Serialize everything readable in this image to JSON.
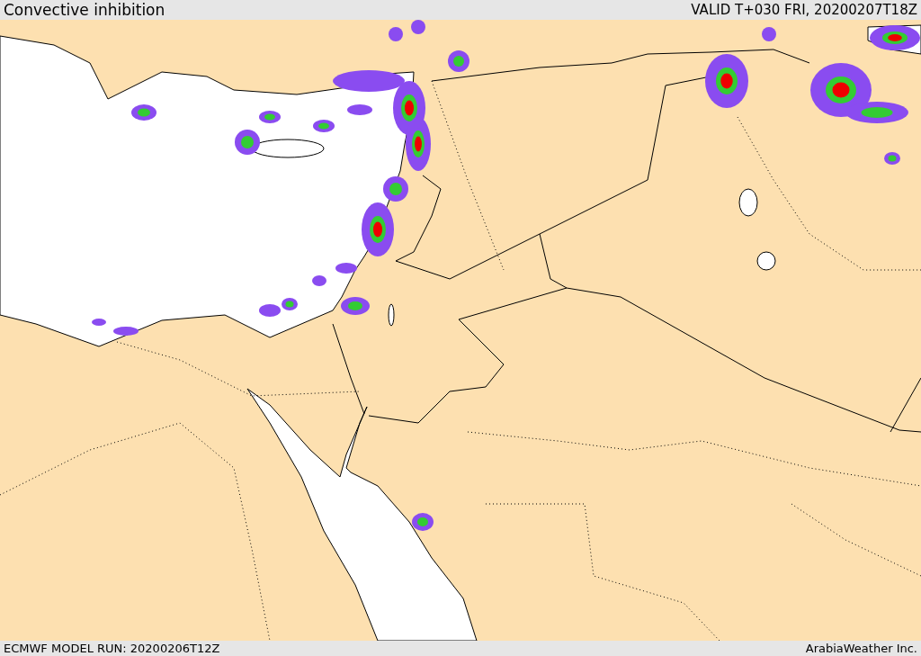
{
  "header": {
    "title": "Convective inhibition",
    "valid": "VALID T+030 FRI, 20200207T18Z"
  },
  "footer": {
    "model_run": "ECMWF MODEL RUN: 20200206T12Z",
    "credit": "ArabiaWeather Inc."
  }
}
